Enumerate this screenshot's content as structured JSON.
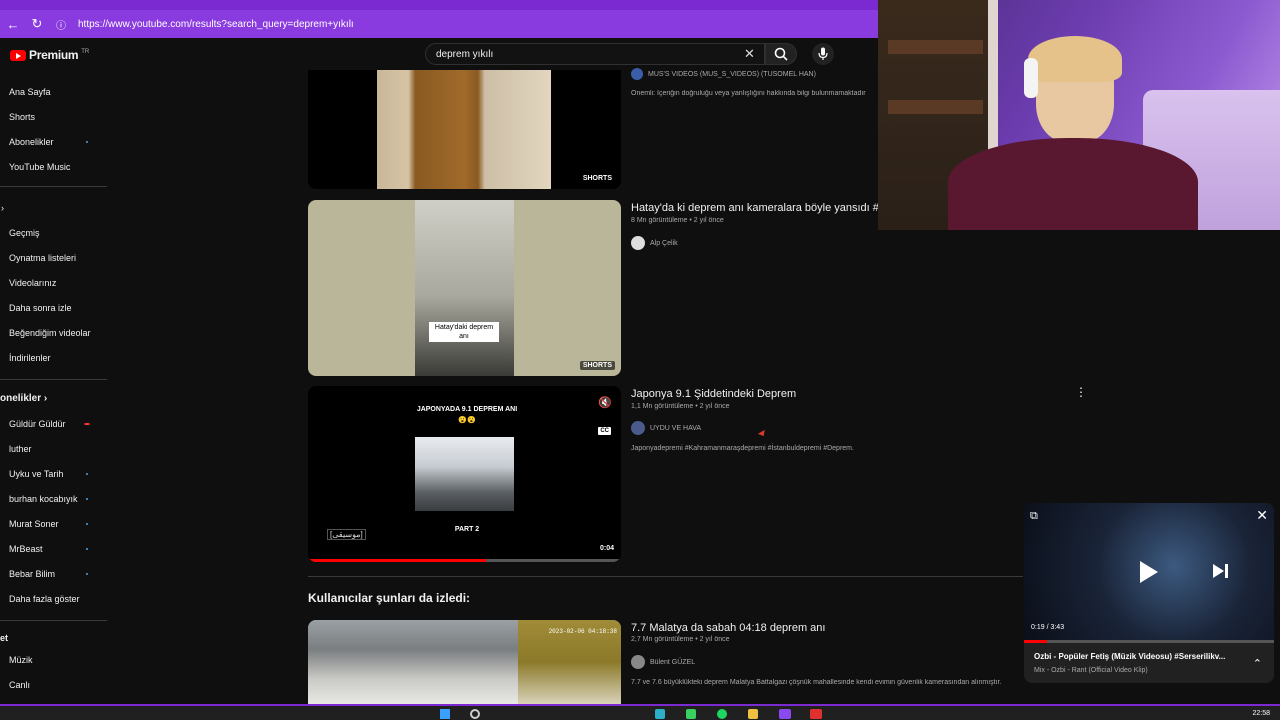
{
  "browser": {
    "url": "https://www.youtube.com/results?search_query=deprem+yıkılı"
  },
  "header": {
    "logo_text": "Premium",
    "logo_sup": "TR",
    "search_value": "deprem yıkılı"
  },
  "sidebar": {
    "main": [
      "Ana Sayfa",
      "Shorts",
      "Abonelikler",
      "YouTube Music"
    ],
    "you_chevron": "›",
    "you": [
      "Geçmiş",
      "Oynatma listeleri",
      "Videolarınız",
      "Daha sonra izle",
      "Beğendiğim videolar",
      "İndirilenler"
    ],
    "subs_heading": "onelikler ›",
    "subs": [
      "Güldür Güldür",
      "luther",
      "Uyku ve Tarih",
      "burhan kocabıyık",
      "Murat Soner",
      "MrBeast",
      "Bebar Bilim",
      "Daha fazla göster"
    ],
    "explore_heading": "et",
    "explore": [
      "Müzik",
      "Canlı"
    ]
  },
  "videos": [
    {
      "channel": "MUS'S VIDEOS (MUS_S_VIDEOS) (TUSOMEL HAN)",
      "desc": "Önemli: İçeriğin doğruluğu veya yanlışlığını hakkında bilgi bulunmamaktadır",
      "badge": "SHORTS"
    },
    {
      "title": "Hatay'da ki deprem anı kameralara böyle yansıdı #",
      "meta": "8 Mn görüntüleme • 2 yıl önce",
      "channel": "Alp Çelik",
      "overlay": "Hatay'daki deprem anı",
      "badge": "SHORTS"
    },
    {
      "title": "Japonya 9.1 Şiddetindeki Deprem",
      "meta": "1,1 Mn görüntüleme • 2 yıl önce",
      "channel": "UYDU VE HAVA",
      "desc": "Japonyadepremi #Kahramanmaraşdepremi #İstanbuldepremi #Deprem.",
      "overlay_top": "JAPONYADA 9.1 DEPREM ANI😮😮",
      "overlay_bottom": "PART 2",
      "caption": "[موسيقى]",
      "time": "0:04",
      "progress": 0.57
    }
  ],
  "section_title": "Kullanıcılar şunları da izledi:",
  "video4": {
    "title": "7.7 Malatya da sabah 04:18 deprem anı",
    "meta": "2,7 Mn görüntüleme • 2 yıl önce",
    "channel": "Bülent GÜZEL",
    "desc": "7.7 ve 7.6 büyüklükteki deprem Malatya Battalgazi çöşnük mahallesinde kendi evimin güvenlik kamerasından alınmıştır.",
    "stamp": "2023-02-06 04:18:38"
  },
  "miniplayer": {
    "time": "0:19 / 3:43",
    "progress": 0.09,
    "title": "Ozbi - Popüler Fetiş (Müzik Videosu) #Serserilikv...",
    "subtitle": "Mix - Ozbi - Rant (Official Video Klip)"
  },
  "taskbar": {
    "clock": "22:58"
  }
}
